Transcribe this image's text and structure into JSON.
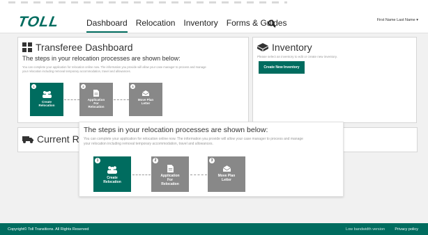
{
  "brand": {
    "logo_text": "TOLL",
    "accent": "#006c5f"
  },
  "nav": {
    "items": [
      {
        "label": "Dashboard",
        "active": true
      },
      {
        "label": "Relocation",
        "active": false
      },
      {
        "label": "Inventory",
        "active": false
      },
      {
        "label": "Forms & Guides",
        "active": false
      }
    ],
    "search_icon": "search-icon"
  },
  "user": {
    "name": "First Name Last Name ▾"
  },
  "dashboard": {
    "title": "Transferee Dashboard",
    "steps_heading": "The steps in your relocation processes are shown below:",
    "description_line1": "You can complete your application for relocation online now. The information you provide will allow your case manager to process and manage",
    "description_line2": "your relocation including removal temporary accommodation, travel and allowances.",
    "steps": [
      {
        "number": "1",
        "label_line1": "Create",
        "label_line2": "Relocation",
        "label_line3": "",
        "icon": "people-icon",
        "status": "active"
      },
      {
        "number": "2",
        "label_line1": "Application",
        "label_line2": "For",
        "label_line3": "Relocation",
        "icon": "document-icon",
        "status": "inactive"
      },
      {
        "number": "3",
        "label_line1": "Move Plan",
        "label_line2": "Letter",
        "label_line3": "",
        "icon": "envelope-icon",
        "status": "inactive"
      }
    ]
  },
  "inventory": {
    "title": "Inventory",
    "description": "Please select an inventory to edit or create new inventory.",
    "button_label": "Create New Inventory"
  },
  "current": {
    "title": "Current Re"
  },
  "footer": {
    "copyright": "Copyright© Toll Transitions. All Rights Reserved",
    "low_bandwidth": "Low bandwidth version",
    "privacy": "Privacy policy"
  }
}
